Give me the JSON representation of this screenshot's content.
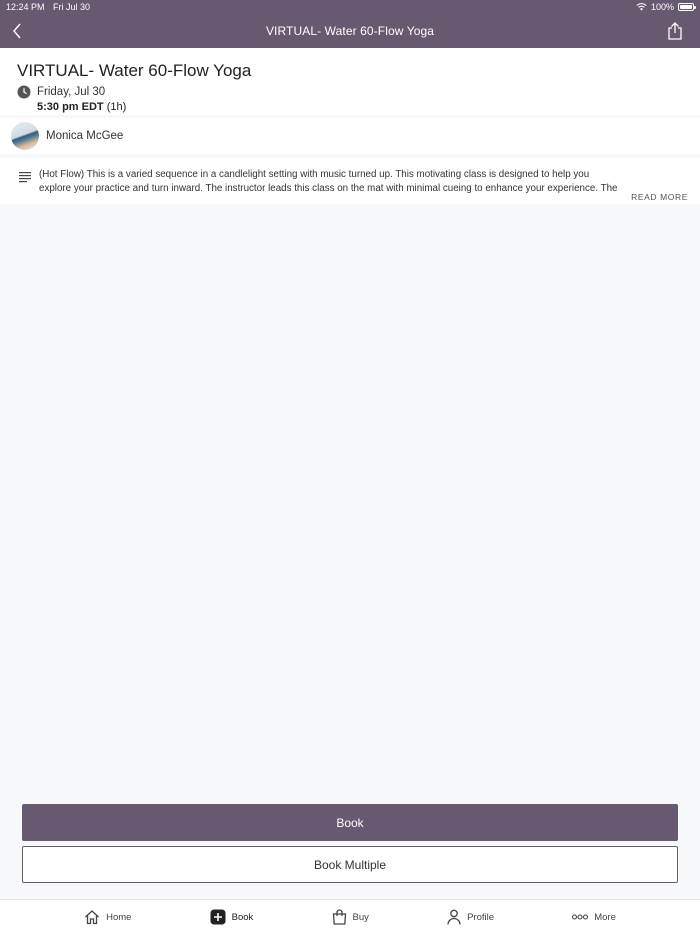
{
  "status_bar": {
    "time": "12:24 PM",
    "date": "Fri Jul 30",
    "battery": "100%"
  },
  "nav": {
    "title": "VIRTUAL- Water 60-Flow Yoga",
    "back_icon": "chevron-left-icon",
    "share_icon": "share-icon"
  },
  "class": {
    "title": "VIRTUAL- Water 60-Flow Yoga",
    "date": "Friday, Jul 30",
    "time": "5:30 pm EDT",
    "duration": "(1h)"
  },
  "instructor": {
    "name": "Monica McGee"
  },
  "description": {
    "text": "(Hot Flow) This is a varied sequence in a candlelight setting with music turned up. This motivating class is designed to help you explore your practice and turn inward. The instructor leads this class on the mat with minimal cueing to enhance your experience. The music in t...",
    "read_more": "READ MORE"
  },
  "actions": {
    "book": "Book",
    "book_multiple": "Book Multiple"
  },
  "tabs": [
    {
      "label": "Home",
      "icon": "home-icon"
    },
    {
      "label": "Book",
      "icon": "plus-icon",
      "active": true
    },
    {
      "label": "Buy",
      "icon": "bag-icon"
    },
    {
      "label": "Profile",
      "icon": "person-icon"
    },
    {
      "label": "More",
      "icon": "more-icon"
    }
  ],
  "colors": {
    "brand": "#67596f",
    "background": "#f7f8fa"
  }
}
